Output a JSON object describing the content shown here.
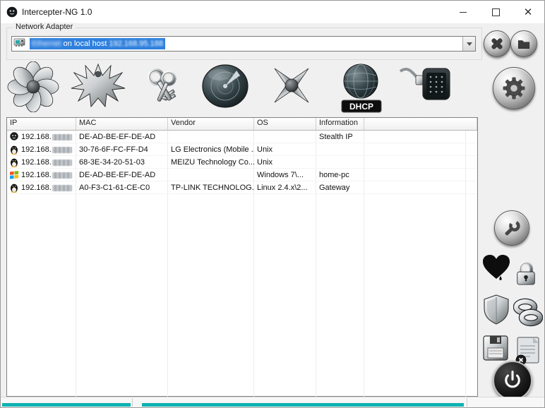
{
  "window": {
    "title": "Intercepter-NG 1.0"
  },
  "adapter": {
    "group_label": "Network Adapter",
    "selected_name": "Ethernet",
    "selected_mid": " on local host ",
    "selected_ip": "192.168.95.188"
  },
  "toolbar": {
    "dhcp_label": "DHCP",
    "icons": [
      "messenger-flower",
      "phoenix",
      "keys",
      "scan-radar",
      "smart-scan-swords",
      "dhcp-globe",
      "nat-connector",
      "settings-gear"
    ]
  },
  "table": {
    "columns": [
      "IP",
      "MAC",
      "Vendor",
      "OS",
      "Information"
    ],
    "rows": [
      {
        "icon": "stealth-icon",
        "ip": "192.168.",
        "mac": "DE-AD-BE-EF-DE-AD",
        "vendor": "",
        "os": "",
        "info": "Stealth IP"
      },
      {
        "icon": "linux-icon",
        "ip": "192.168.",
        "mac": "30-76-6F-FC-FF-D4",
        "vendor": "LG Electronics (Mobile ...",
        "os": "Unix",
        "info": ""
      },
      {
        "icon": "linux-icon",
        "ip": "192.168.",
        "mac": "68-3E-34-20-51-03",
        "vendor": "MEIZU Technology Co...",
        "os": "Unix",
        "info": ""
      },
      {
        "icon": "windows-icon",
        "ip": "192.168.",
        "mac": "DE-AD-BE-EF-DE-AD",
        "vendor": "",
        "os": "Windows 7\\...",
        "info": "home-pc"
      },
      {
        "icon": "linux-icon",
        "ip": "192.168.",
        "mac": "A0-F3-C1-61-CE-C0",
        "vendor": "TP-LINK TECHNOLOG...",
        "os": "Linux 2.4.x\\2...",
        "info": "Gateway"
      }
    ]
  },
  "sidebar": {
    "icons": [
      "wrench",
      "heartbleed-heart",
      "padlock",
      "shield",
      "rings",
      "save-floppy",
      "log-note",
      "power"
    ]
  },
  "colors": {
    "accent_teal": "#10b2b2",
    "selection_blue": "#2f80de"
  }
}
